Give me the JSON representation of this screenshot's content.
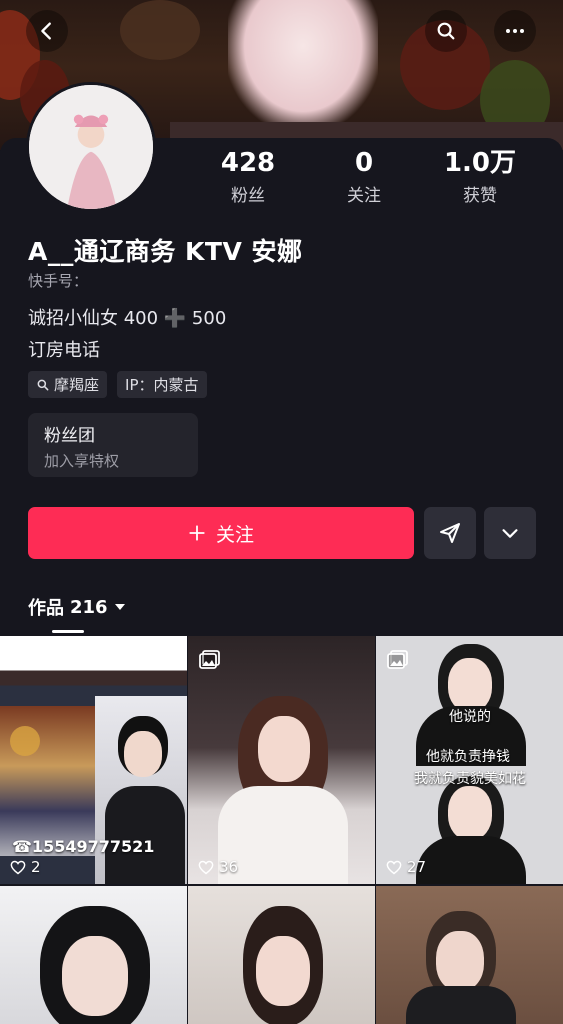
{
  "header": {
    "back_icon": "back-arrow-icon",
    "search_icon": "search-icon",
    "more_icon": "more-icon"
  },
  "profile": {
    "stats": [
      {
        "value": "428",
        "label": "粉丝"
      },
      {
        "value": "0",
        "label": "关注"
      },
      {
        "value": "1.0万",
        "label": "获赞"
      }
    ],
    "name": "A__通辽商务 KTV 安娜",
    "kuaishou_id_label": "快手号：",
    "bio_line1": "诚招小仙女 400 ➕ 500",
    "bio_line2": "订房电话",
    "tags": [
      {
        "icon": "search-icon",
        "text": "摩羯座"
      },
      {
        "text": "IP：内蒙古"
      }
    ],
    "fanclub": {
      "title": "粉丝团",
      "subtitle": "加入享特权"
    }
  },
  "actions": {
    "follow_label": "关注",
    "follow_color": "#fe2c55"
  },
  "works": {
    "tab_label": "作品",
    "count": "216"
  },
  "grid": [
    {
      "likes": "2",
      "phone": "☎15549777521"
    },
    {
      "likes": "36"
    },
    {
      "likes": "27",
      "caption1": "他说的",
      "caption2": "他就负责挣钱",
      "caption3": "我就负责貌美如花"
    },
    {},
    {},
    {}
  ]
}
